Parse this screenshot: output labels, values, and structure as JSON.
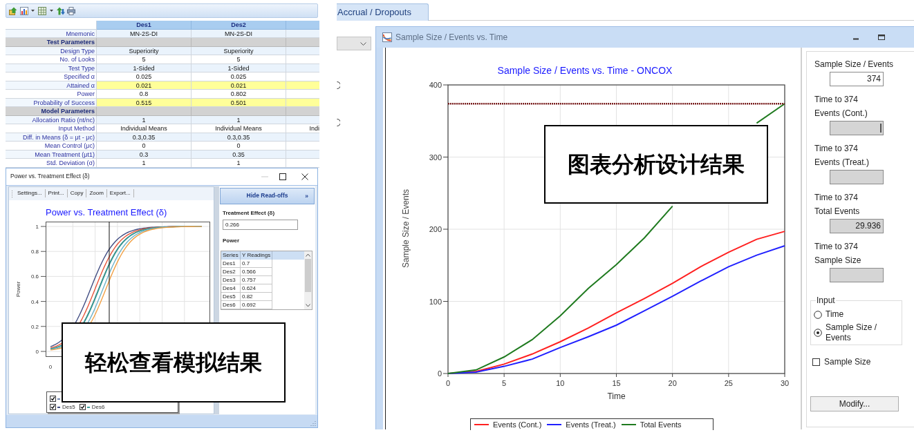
{
  "results_table": {
    "columns": [
      "Des1",
      "Des2"
    ],
    "rows": [
      {
        "kind": "data",
        "label": "Mnemonic",
        "values": [
          "MN-2S-DI",
          "MN-2S-DI"
        ],
        "highlighted": false
      },
      {
        "kind": "section",
        "label": "Test Parameters"
      },
      {
        "kind": "data",
        "label": "Design Type",
        "values": [
          "Superiority",
          "Superiority"
        ],
        "highlighted": false
      },
      {
        "kind": "data",
        "label": "No. of Looks",
        "values": [
          "5",
          "5"
        ],
        "highlighted": false
      },
      {
        "kind": "data",
        "label": "Test Type",
        "values": [
          "1-Sided",
          "1-Sided"
        ],
        "highlighted": false
      },
      {
        "kind": "data",
        "label": "Specified α",
        "values": [
          "0.025",
          "0.025"
        ],
        "highlighted": false
      },
      {
        "kind": "data",
        "label": "Attained α",
        "values": [
          "0.021",
          "0.021"
        ],
        "highlighted": true
      },
      {
        "kind": "data",
        "label": "Power",
        "values": [
          "0.8",
          "0.802"
        ],
        "highlighted": false
      },
      {
        "kind": "data",
        "label": "Probability of Success",
        "values": [
          "0.515",
          "0.501"
        ],
        "highlighted": true
      },
      {
        "kind": "section",
        "label": "Model Parameters"
      },
      {
        "kind": "data",
        "label": "Allocation Ratio (nt/nc)",
        "values": [
          "1",
          "1"
        ],
        "highlighted": false
      },
      {
        "kind": "data",
        "label": "Input Method",
        "values": [
          "Individual Means",
          "Individual Means",
          "Indi"
        ],
        "highlighted": false
      },
      {
        "kind": "data",
        "label": "Diff. in Means (δ = μt - μc)",
        "values": [
          "0.3,0.35",
          "0.3,0.35"
        ],
        "highlighted": false
      },
      {
        "kind": "data",
        "label": "Mean Control (μc)",
        "values": [
          "0",
          "0"
        ],
        "highlighted": false
      },
      {
        "kind": "data",
        "label": "Mean Treatment (μt1)",
        "values": [
          "0.3",
          "0.35"
        ],
        "highlighted": false
      },
      {
        "kind": "data",
        "label": "Std. Deviation (σ)",
        "values": [
          "1",
          "1"
        ],
        "highlighted": false
      }
    ]
  },
  "power_window": {
    "title": "Power vs. Treatment Effect (δ)",
    "menu": [
      "Settings...",
      "Print...",
      "Copy",
      "Zoom",
      "Export..."
    ],
    "chart": {
      "title": "Power vs. Treatment Effect (δ)",
      "y_axis_label": "Power",
      "y_tick_labels": [
        "1",
        "0.8",
        "0.6",
        "0.4",
        "0.2",
        "0"
      ],
      "x_tick_labels": [
        "0"
      ]
    },
    "legend_rows": [
      [
        {
          "checked": true,
          "color": "#6f86b0"
        }
      ],
      [
        {
          "label": "Des5",
          "checked": true,
          "color": "#404c82"
        },
        {
          "label": "Des6",
          "checked": true,
          "color": "#3d9e9c"
        }
      ]
    ],
    "readoffs": {
      "button": "Hide Read-offs",
      "button_icon": "»",
      "effect_label": "Treatment Effect (δ)",
      "effect_value": "0.266",
      "output_label": "Power",
      "columns": [
        "Series",
        "Y Readings"
      ],
      "rows": [
        [
          "Des1",
          "0.7"
        ],
        [
          "Des2",
          "0.566"
        ],
        [
          "Des3",
          "0.757"
        ],
        [
          "Des4",
          "0.624"
        ],
        [
          "Des5",
          "0.82"
        ],
        [
          "Des6",
          "0.692"
        ]
      ]
    },
    "callout": "轻松查看模拟结果"
  },
  "tabs": [
    {
      "label": "Accrual / Dropouts",
      "selected": true
    }
  ],
  "events_window": {
    "title": "Sample Size / Events vs. Time",
    "chart_data": {
      "type": "line",
      "title": "Sample Size / Events vs. Time - ONCOX",
      "xlabel": "Time",
      "ylabel": "Sample Size / Events",
      "x": [
        0,
        2.5,
        5,
        7.5,
        10,
        12.5,
        15,
        17.5,
        20,
        22.5,
        25,
        27.5,
        30
      ],
      "series": [
        {
          "name": "Events (Cont.)",
          "color": "#ff2020",
          "values": [
            0,
            3,
            13,
            27,
            44,
            63,
            84,
            104,
            125,
            148,
            168,
            186,
            197
          ]
        },
        {
          "name": "Events (Treat.)",
          "color": "#2020ff",
          "values": [
            0,
            2,
            10,
            20,
            36,
            51,
            67,
            87,
            107,
            128,
            148,
            164,
            177
          ]
        },
        {
          "name": "Total Events",
          "color": "#1f7a1f",
          "values": [
            0,
            5,
            23,
            47,
            80,
            118,
            151,
            188,
            232,
            null,
            null,
            347,
            374
          ]
        }
      ],
      "xlim": [
        0,
        30
      ],
      "ylim": [
        0,
        400
      ],
      "xticks": [
        {
          "value": 0,
          "label": "0"
        },
        {
          "value": 5,
          "label": "5"
        },
        {
          "value": 10,
          "label": "10"
        },
        {
          "value": 15,
          "label": "15"
        },
        {
          "value": 20,
          "label": "20"
        },
        {
          "value": 25,
          "label": "25"
        },
        {
          "value": 30,
          "label": "30"
        }
      ],
      "yticks": [
        {
          "value": 0,
          "label": "0"
        },
        {
          "value": 100,
          "label": "100"
        },
        {
          "value": 200,
          "label": "200"
        },
        {
          "value": 300,
          "label": "300"
        },
        {
          "value": 400,
          "label": "400"
        }
      ],
      "grid": true,
      "legend": "bottom",
      "ref_lines": [
        {
          "axis": "y",
          "value": 374
        }
      ]
    },
    "callout": "图表分析设计结果",
    "side_panel": {
      "fields": [
        {
          "kind": "input",
          "label": "Sample Size / Events",
          "value": "374",
          "focused": false
        },
        {
          "kind": "readout",
          "label": "Time to 374 Events (Cont.)",
          "focused": true
        },
        {
          "kind": "readout",
          "label": "Time to 374 Events (Treat.)",
          "focused": false
        },
        {
          "kind": "readout",
          "label": "Time to 374 Total Events",
          "value": "29.936",
          "focused": false
        },
        {
          "kind": "readout",
          "label": "Time to 374 Sample Size",
          "focused": false
        }
      ],
      "input_group": {
        "title": "Input",
        "options": [
          {
            "label": "Time",
            "selected": false
          },
          {
            "label": "Sample Size / Events",
            "selected": true
          }
        ]
      },
      "checkbox": {
        "label": "Sample Size",
        "checked": false
      },
      "button": "Modify..."
    }
  }
}
